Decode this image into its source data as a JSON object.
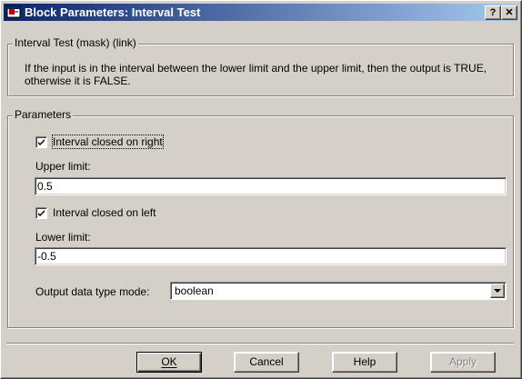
{
  "window": {
    "title": "Block Parameters: Interval Test",
    "help_glyph": "?",
    "close_glyph": "✕"
  },
  "description_group": {
    "legend": "Interval Test (mask) (link)",
    "text": "If the input is in the interval between the lower limit and the upper limit, then the output is TRUE, otherwise it is FALSE."
  },
  "parameters": {
    "legend": "Parameters",
    "closed_right": {
      "label": "Interval closed on right",
      "checked": true
    },
    "upper_limit": {
      "label": "Upper limit:",
      "value": "0.5"
    },
    "closed_left": {
      "label": "Interval closed on left",
      "checked": true
    },
    "lower_limit": {
      "label": "Lower limit:",
      "value": "-0.5"
    },
    "output_type": {
      "label": "Output data type mode:",
      "value": "boolean"
    }
  },
  "buttons": {
    "ok": "OK",
    "cancel": "Cancel",
    "help": "Help",
    "apply": "Apply"
  }
}
